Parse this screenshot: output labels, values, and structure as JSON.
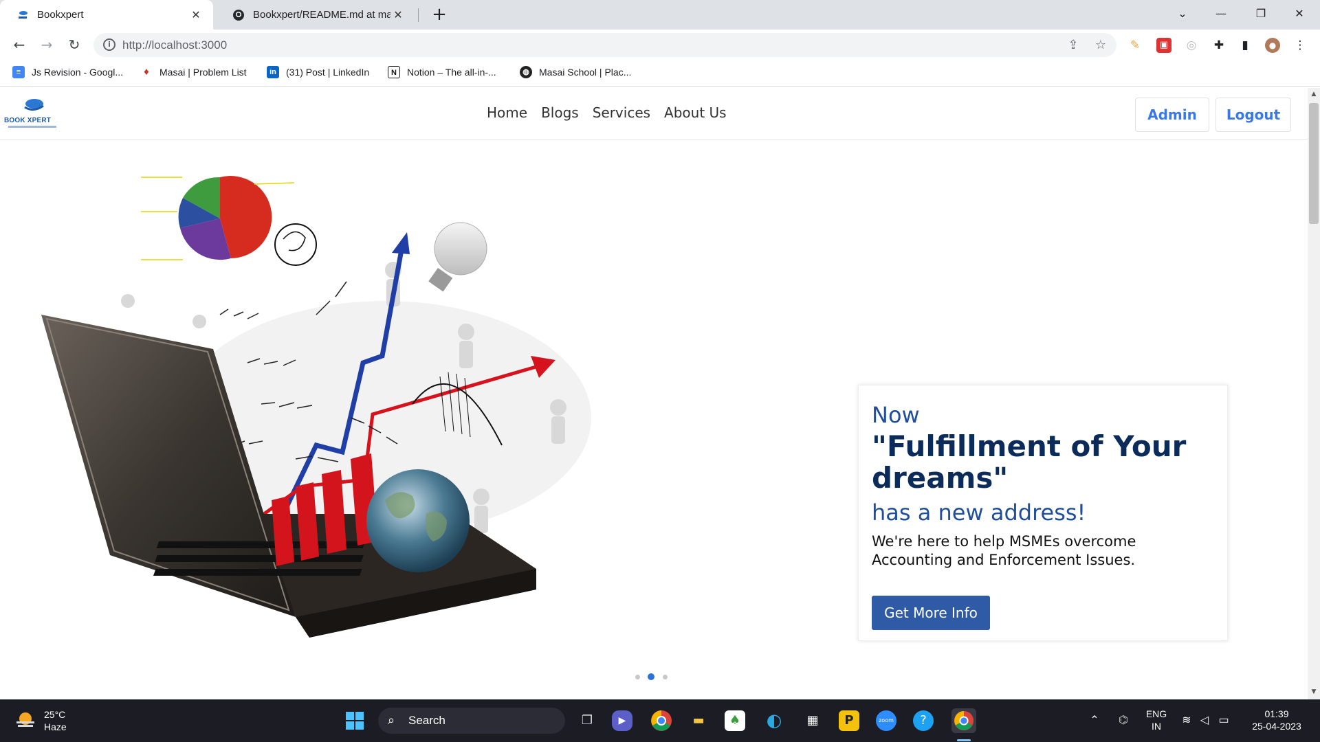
{
  "browser": {
    "tabs": [
      {
        "title": "Bookxpert",
        "close": "✕"
      },
      {
        "title": "Bookxpert/README.md at main ·",
        "close": "✕"
      }
    ],
    "new_tab": "+",
    "window_controls": {
      "minimize": "—",
      "restore": "❐",
      "close": "✕",
      "dropdown": "⌄"
    },
    "url": "http://localhost:3000",
    "bookmarks": [
      {
        "label": "Js Revision - Googl...",
        "icon": "docs-icon",
        "color": "#4285f4"
      },
      {
        "label": "Masai | Problem List",
        "icon": "masai-icon",
        "color": "#c0392b"
      },
      {
        "label": "(31) Post | LinkedIn",
        "icon": "linkedin-icon",
        "color": "#0a66c2"
      },
      {
        "label": "Notion – The all-in-...",
        "icon": "notion-icon",
        "color": "#111111"
      },
      {
        "label": "Masai School | Plac...",
        "icon": "globe-icon",
        "color": "#222222"
      }
    ]
  },
  "site": {
    "logo_text": "BOOK XPERT",
    "nav": [
      "Home",
      "Blogs",
      "Services",
      "About Us"
    ],
    "admin_button": "Admin",
    "logout_button": "Logout",
    "accent": "#3b78e7"
  },
  "hero": {
    "now": "Now",
    "headline": "\"Fulfillment of Your dreams\"",
    "address": "has a new address!",
    "description": "We're here to help MSMEs overcome Accounting and Enforcement Issues.",
    "cta": "Get More Info",
    "carousel_active_index": 1,
    "carousel_count": 3
  },
  "taskbar": {
    "weather_temp": "25°C",
    "weather_cond": "Haze",
    "search_label": "Search",
    "lang_top": "ENG",
    "lang_bottom": "IN",
    "time": "01:39",
    "date": "25-04-2023"
  }
}
